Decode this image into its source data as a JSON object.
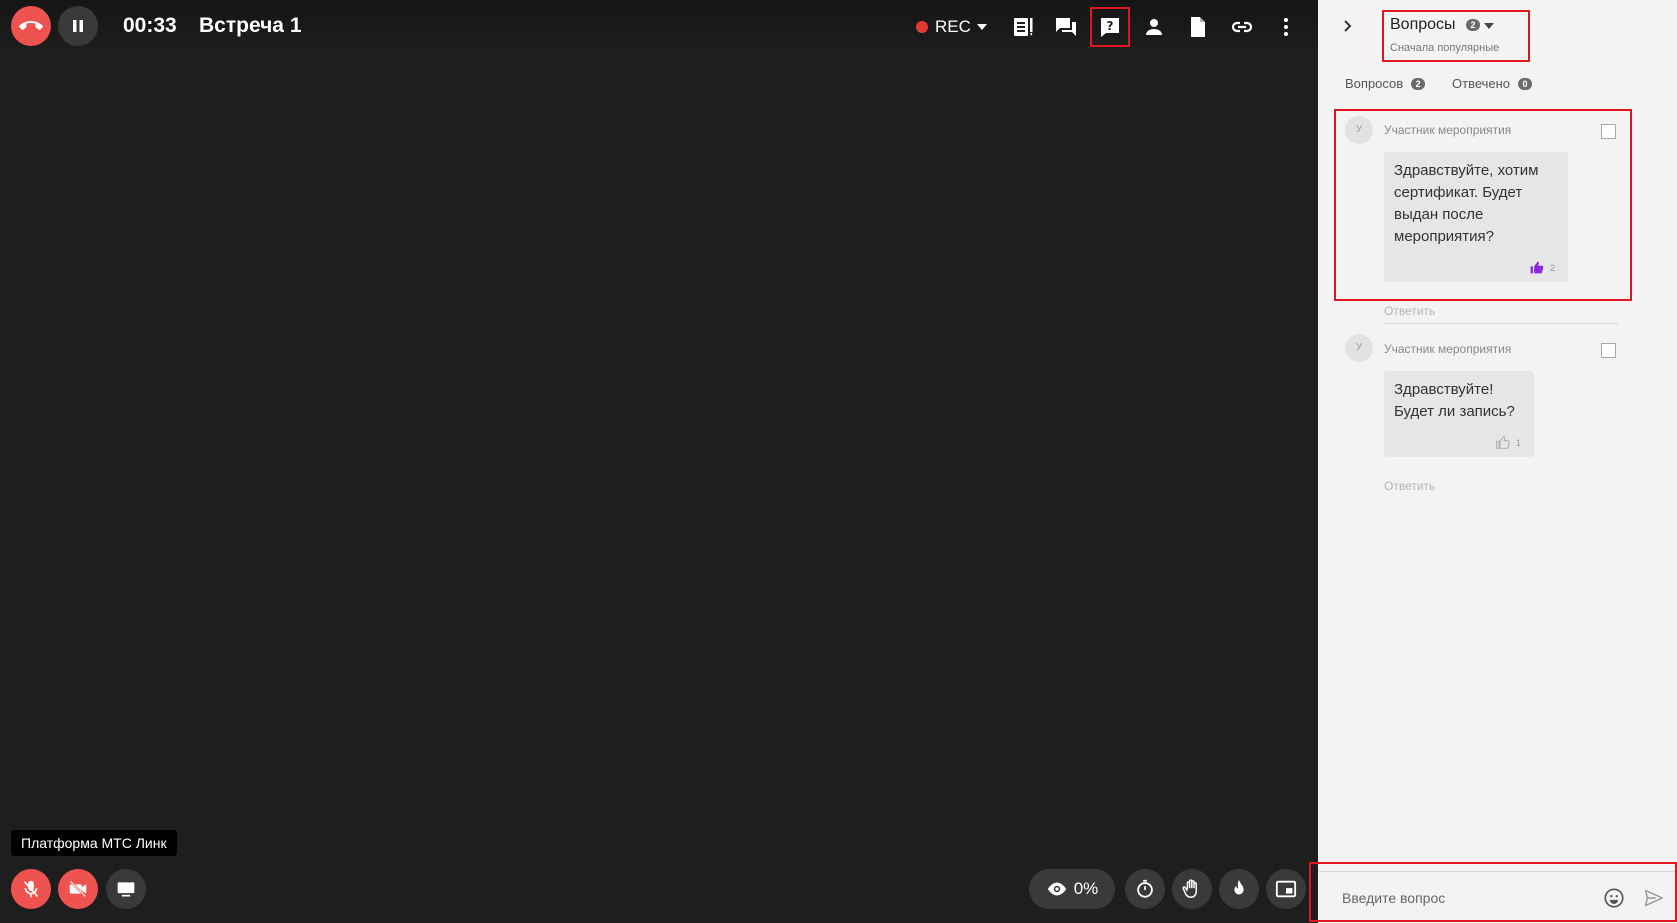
{
  "call": {
    "timer": "00:33",
    "title": "Встреча 1",
    "rec_label": "REC",
    "view_percent": "0%",
    "speaker_tag": "Платформа МТС Линк"
  },
  "colors": {
    "accent_red": "#ef5350",
    "highlight": "#e0161f",
    "like_active": "#8a2be2"
  },
  "toolbar": {
    "icons": [
      "notes-icon",
      "chat-icon",
      "questions-icon",
      "participants-icon",
      "document-icon",
      "link-icon",
      "more-icon"
    ]
  },
  "panel": {
    "title": "Вопросы",
    "count": "2",
    "sort_label": "Сначала популярные",
    "tabs": [
      {
        "label": "Вопросов",
        "count": "2"
      },
      {
        "label": "Отвечено",
        "count": "0"
      }
    ],
    "questions": [
      {
        "avatar": "У",
        "author": "Участник мероприятия",
        "lines": [
          "Здравствуйте, хотим",
          "сертификат. Будет",
          "выдан после",
          "мероприятия?"
        ],
        "likes": "2",
        "reply_label": "Ответить"
      },
      {
        "avatar": "У",
        "author": "Участник мероприятия",
        "lines": [
          "Здравствуйте!",
          "Будет ли запись?"
        ],
        "likes": "1",
        "reply_label": "Ответить"
      }
    ],
    "input_placeholder": "Введите вопрос"
  }
}
